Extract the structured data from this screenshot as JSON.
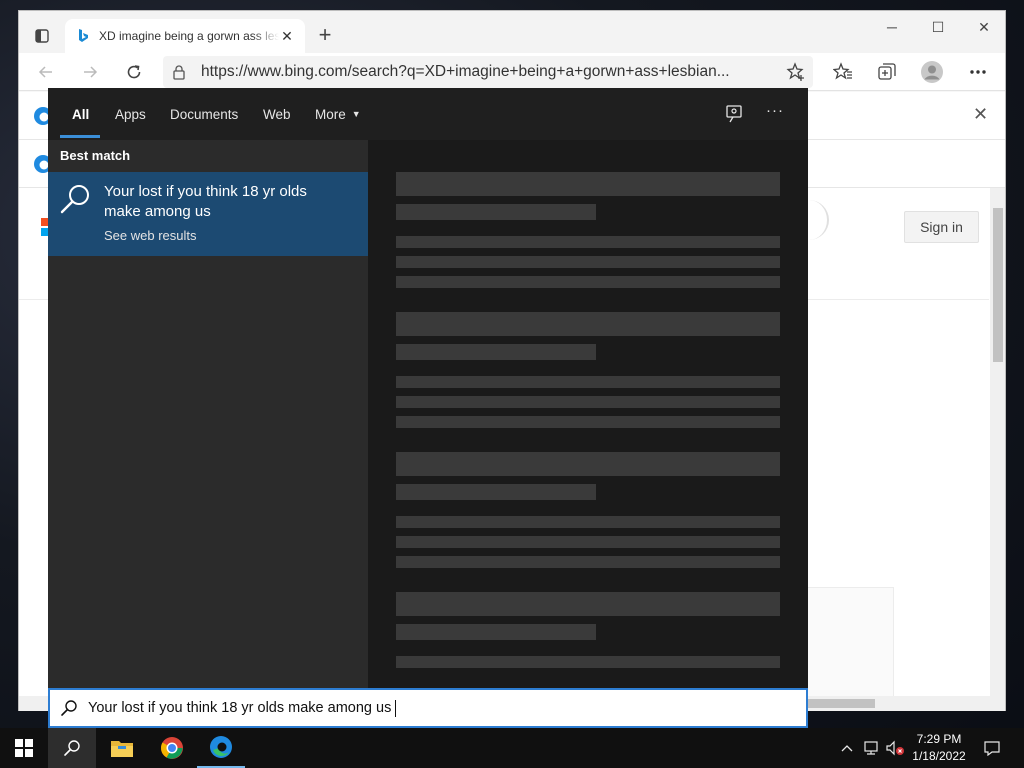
{
  "browser": {
    "tab_title": "XD imagine being a gorwn ass lesbian",
    "tab_close": "✕",
    "new_tab": "+",
    "window_controls": {
      "minimize": "─",
      "maximize": "☐",
      "close": "✕"
    },
    "url": "https://www.bing.com/search?q=XD+imagine+being+a+gorwn+ass+lesbian...",
    "page": {
      "sign_in": "Sign in",
      "infobar_close": "✕"
    }
  },
  "search_panel": {
    "tabs": [
      "All",
      "Apps",
      "Documents",
      "Web",
      "More"
    ],
    "more_arrow": "▼",
    "options": "···",
    "best_match_label": "Best match",
    "best_match": {
      "title": "Your lost if you think 18 yr olds make among us",
      "subtitle": "See web results"
    }
  },
  "search_box": {
    "value": "Your lost if you think 18 yr olds make among us"
  },
  "taskbar": {
    "time": "7:29 PM",
    "date": "1/18/2022"
  },
  "colors": {
    "panel_bg": "#1f1f1f",
    "panel_left": "#2b2b2b",
    "best_match_bg": "#1c4a72",
    "accent": "#2d7dd2",
    "taskbar": "#101010"
  }
}
